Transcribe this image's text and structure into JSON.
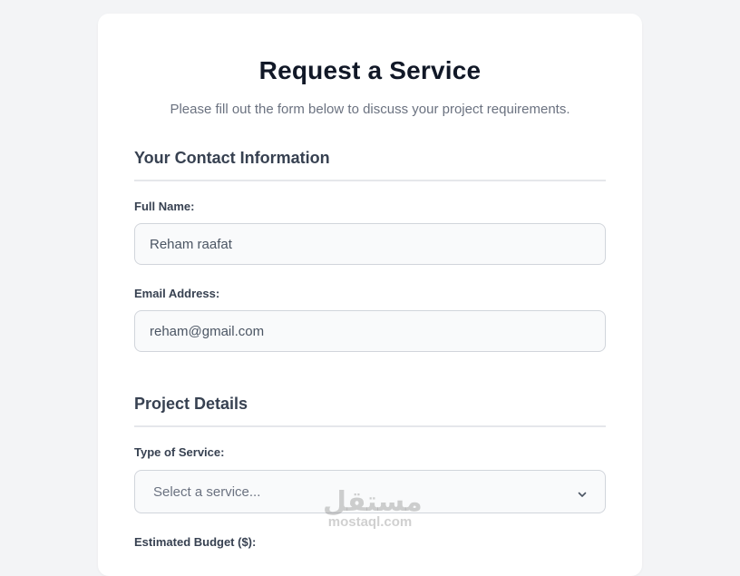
{
  "header": {
    "title": "Request a Service",
    "subtitle": "Please fill out the form below to discuss your project requirements."
  },
  "contact_section": {
    "heading": "Your Contact Information",
    "full_name": {
      "label": "Full Name:",
      "value": "Reham raafat"
    },
    "email": {
      "label": "Email Address:",
      "value": "reham@gmail.com"
    }
  },
  "project_section": {
    "heading": "Project Details",
    "service_type": {
      "label": "Type of Service:",
      "selected": "Select a service...",
      "icon": "chevron-down-icon"
    },
    "budget": {
      "label": "Estimated Budget ($):"
    }
  },
  "watermark": {
    "main": "مستقل",
    "sub": "mostaql.com"
  },
  "colors": {
    "background": "#f3f4f6",
    "card": "#ffffff",
    "title": "#111827",
    "input_bg": "#f9fafb",
    "input_border": "#d1d5db"
  }
}
